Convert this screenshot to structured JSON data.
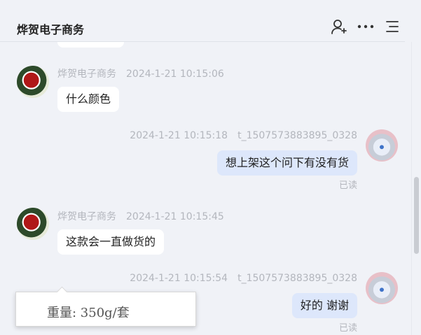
{
  "header": {
    "title": "烨贺电子商务",
    "icons": [
      "add-contact-icon",
      "more-icon",
      "menu-icon"
    ]
  },
  "messages": [
    {
      "sender": "烨贺电子商务",
      "time": "2024-1-21 10:15:06",
      "text": "什么颜色",
      "direction": "in"
    },
    {
      "sender": "t_1507573883895_0328",
      "time": "2024-1-21 10:15:18",
      "text": "想上架这个问下有没有货",
      "direction": "out",
      "status": "已读"
    },
    {
      "sender": "烨贺电子商务",
      "time": "2024-1-21 10:15:45",
      "text": "这款会一直做货的",
      "direction": "in"
    },
    {
      "sender": "t_1507573883895_0328",
      "time": "2024-1-21 10:15:54",
      "text": "好的 谢谢",
      "direction": "out",
      "status": "已读"
    }
  ],
  "tooltip": {
    "text": "重量: 350g/套"
  },
  "colors": {
    "background": "#f0f2f7",
    "outgoing_bubble": "#dde7fb",
    "incoming_bubble": "#ffffff",
    "meta_text": "#b3b6bd"
  }
}
